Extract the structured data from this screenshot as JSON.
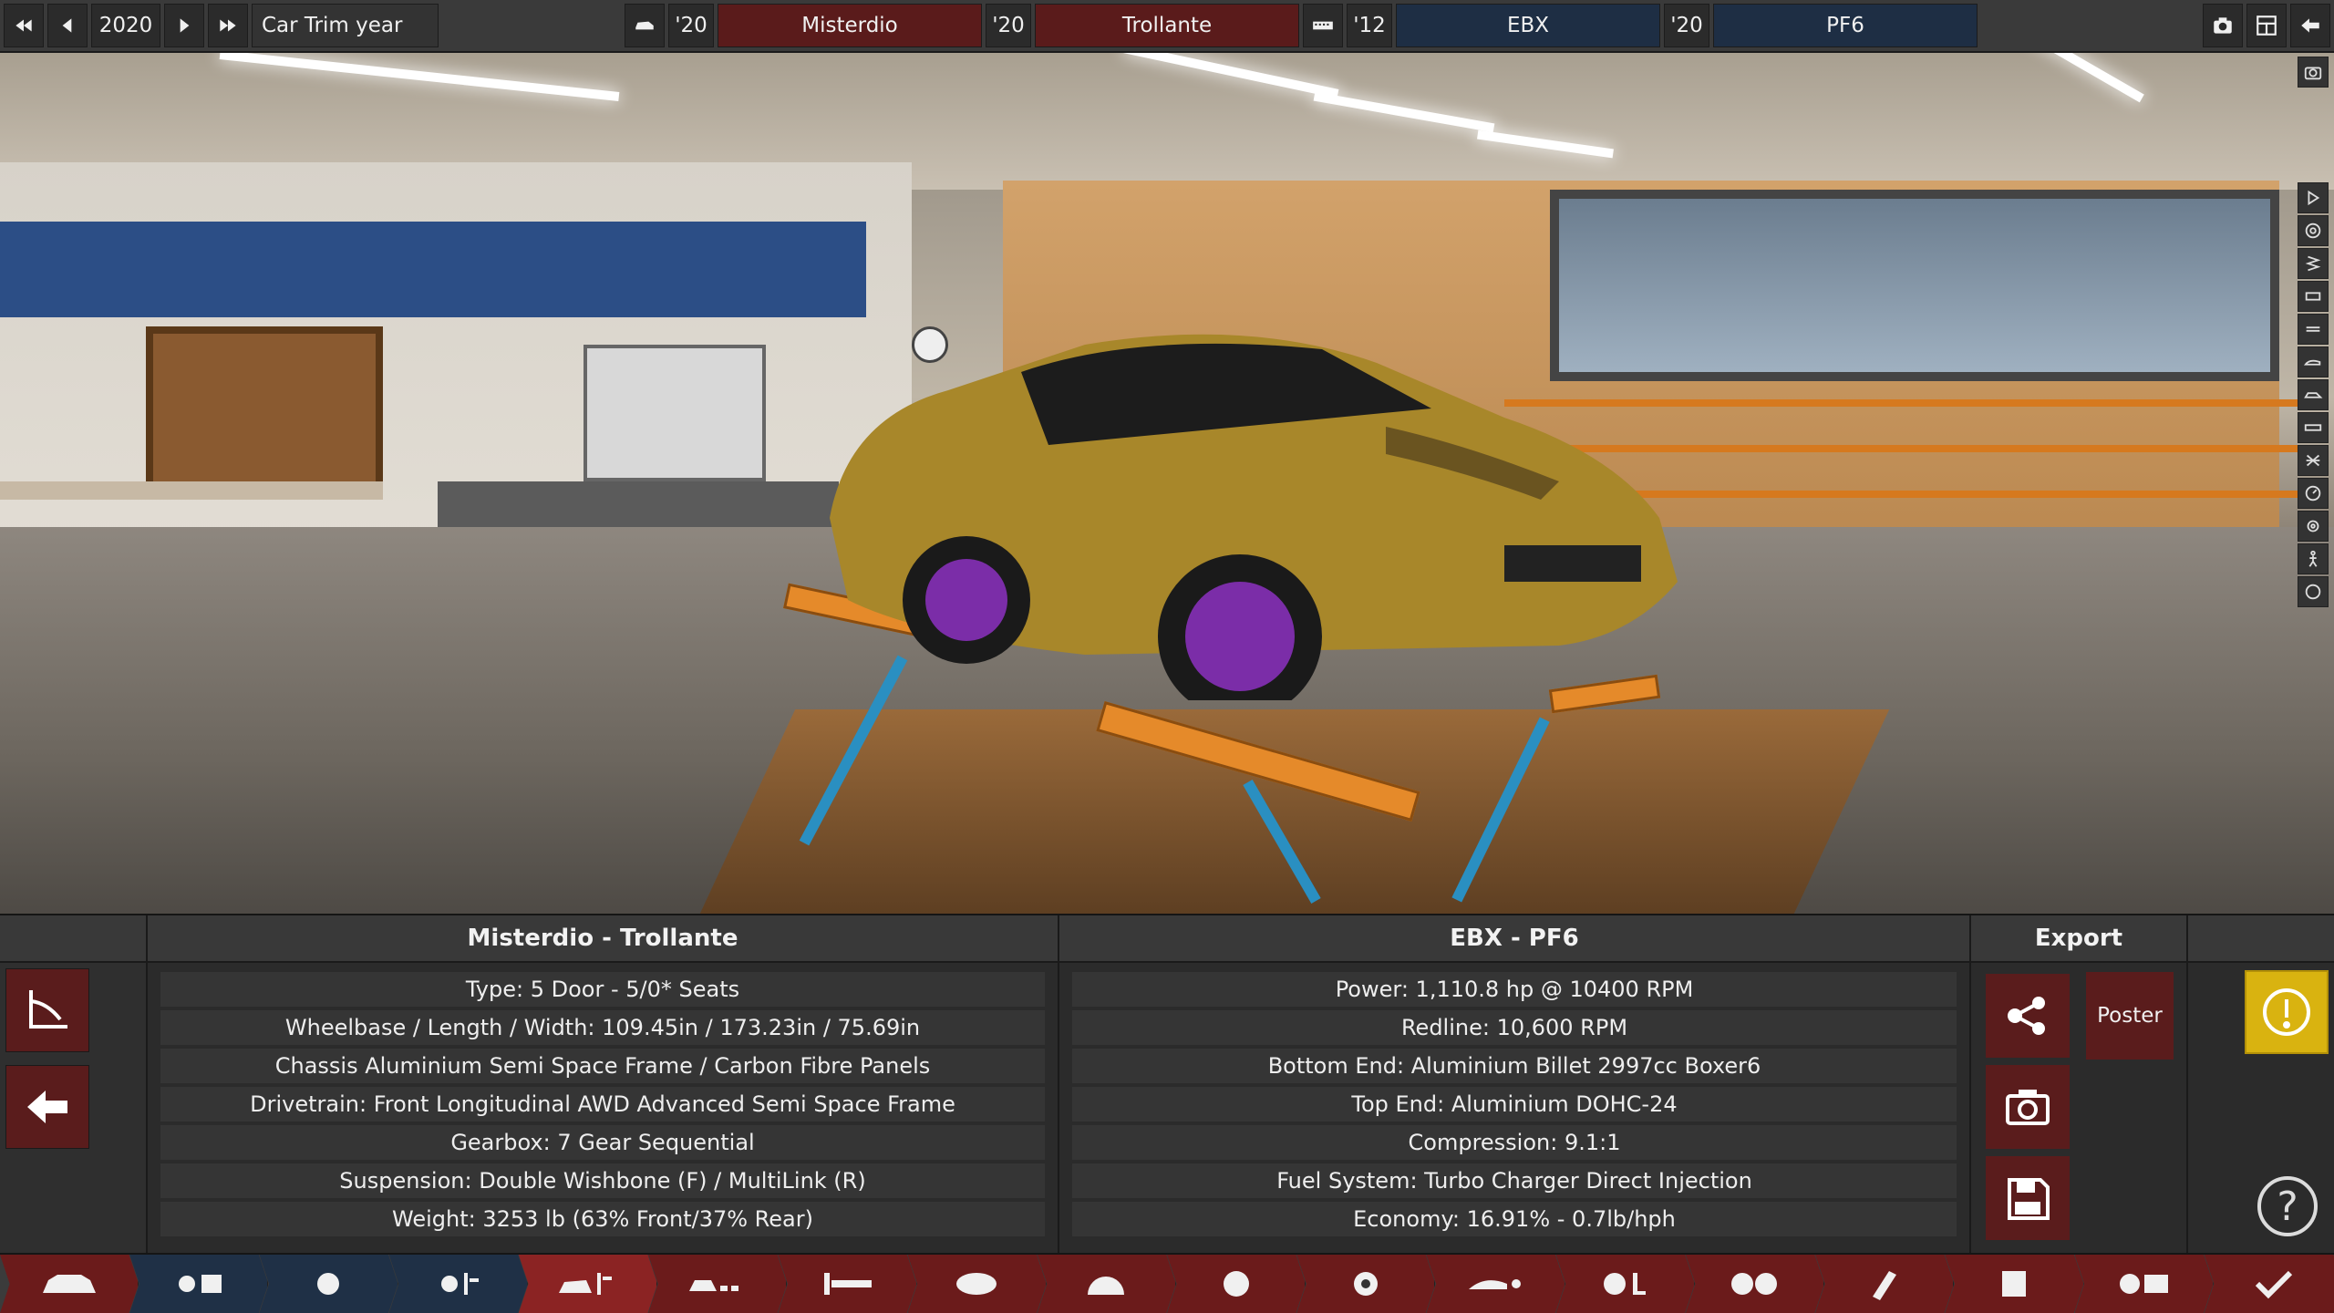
{
  "topbar": {
    "year_value": "2020",
    "year_field_label": "Car Trim year",
    "model_year": "'20",
    "model_name": "Misterdio",
    "trim_year": "'20",
    "trim_name": "Trollante",
    "engine_family_year": "'12",
    "engine_family_name": "EBX",
    "engine_variant_year": "'20",
    "engine_variant_name": "PF6"
  },
  "car_panel": {
    "title": "Misterdio - Trollante",
    "rows": [
      "Type: 5 Door - 5/0* Seats",
      "Wheelbase / Length / Width: 109.45in / 173.23in / 75.69in",
      "Chassis Aluminium Semi Space Frame / Carbon Fibre Panels",
      "Drivetrain: Front Longitudinal AWD Advanced Semi Space Frame",
      "Gearbox: 7 Gear Sequential",
      "Suspension: Double Wishbone (F) / MultiLink (R)",
      "Weight: 3253 lb (63% Front/37% Rear)"
    ]
  },
  "engine_panel": {
    "title": "EBX - PF6",
    "rows": [
      "Power: 1,110.8 hp @ 10400 RPM",
      "Redline:  10,600 RPM",
      "Bottom End: Aluminium Billet 2997cc Boxer6",
      "Top End: Aluminium DOHC-24",
      "Compression: 9.1:1",
      "Fuel System: Turbo Charger Direct Injection",
      "Economy: 16.91% - 0.7lb/hph"
    ]
  },
  "export_panel": {
    "title": "Export",
    "poster_label": "Poster"
  },
  "help_label": "?",
  "colors": {
    "accent_red": "#5a1c1c",
    "accent_blue": "#1e2e44",
    "warning_yellow": "#d9b310",
    "car_gold": "#a8872a",
    "rim_purple": "#7b2da8"
  },
  "bottom_nav": [
    {
      "name": "car-model-icon"
    },
    {
      "name": "engine-family-icon"
    },
    {
      "name": "engine-design-icon"
    },
    {
      "name": "engine-tuning-icon"
    },
    {
      "name": "car-body-icon"
    },
    {
      "name": "fixtures-icon"
    },
    {
      "name": "drivetrain-icon"
    },
    {
      "name": "suspension-icon"
    },
    {
      "name": "brakes-icon"
    },
    {
      "name": "wheels-icon"
    },
    {
      "name": "tyres-icon"
    },
    {
      "name": "aero-icon"
    },
    {
      "name": "interior-icon"
    },
    {
      "name": "safety-icon"
    },
    {
      "name": "test-track-icon"
    },
    {
      "name": "stats-icon"
    },
    {
      "name": "racing-icon"
    },
    {
      "name": "finish-icon"
    }
  ]
}
